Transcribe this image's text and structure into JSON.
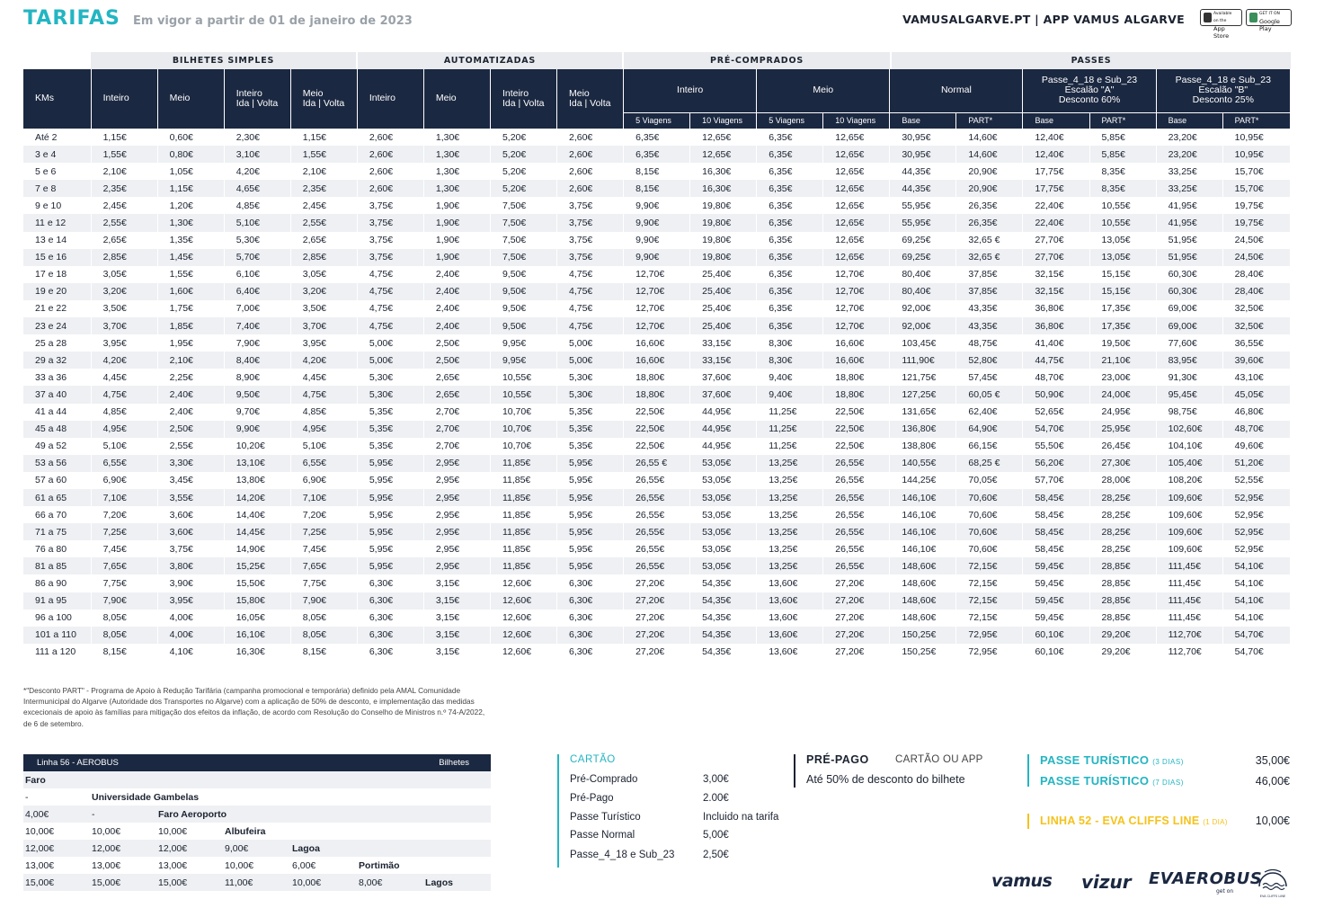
{
  "header": {
    "title": "TARIFAS",
    "subtitle": "Em vigor a partir de 01 de janeiro de 2023",
    "links": "VAMUSALGARVE.PT  |  APP VAMUS ALGARVE",
    "app_store_small": "Available on the",
    "app_store": "App Store",
    "google_play_small": "GET IT ON",
    "google_play": "Google Play"
  },
  "groups": {
    "bilhetes": "BILHETES SIMPLES",
    "automatizadas": "AUTOMATIZADAS",
    "precomprados": "PRÉ-COMPRADOS",
    "passes": "PASSES"
  },
  "columns": {
    "kms": "KMs",
    "inteiro": "Inteiro",
    "meio": "Meio",
    "inteiro_iv_1": "Inteiro",
    "inteiro_iv_2": "Ida | Volta",
    "meio_iv_1": "Meio",
    "meio_iv_2": "Ida | Volta",
    "pc_inteiro": "Inteiro",
    "pc_meio": "Meio",
    "normal": "Normal",
    "passe_a_1": "Passe_4_18 e Sub_23",
    "passe_a_2": "Escalão \"A\"",
    "passe_a_3": "Desconto 60%",
    "passe_b_1": "Passe_4_18 e Sub_23",
    "passe_b_2": "Escalão \"B\"",
    "passe_b_3": "Desconto 25%",
    "v5": "5 Viagens",
    "v10": "10 Viagens",
    "base": "Base",
    "part": "PART*"
  },
  "rows": [
    [
      "Até 2",
      "1,15€",
      "0,60€",
      "2,30€",
      "1,15€",
      "2,60€",
      "1,30€",
      "5,20€",
      "2,60€",
      "6,35€",
      "12,65€",
      "6,35€",
      "12,65€",
      "30,95€",
      "14,60€",
      "12,40€",
      "5,85€",
      "23,20€",
      "10,95€"
    ],
    [
      "3 e 4",
      "1,55€",
      "0,80€",
      "3,10€",
      "1,55€",
      "2,60€",
      "1,30€",
      "5,20€",
      "2,60€",
      "6,35€",
      "12,65€",
      "6,35€",
      "12,65€",
      "30,95€",
      "14,60€",
      "12,40€",
      "5,85€",
      "23,20€",
      "10,95€"
    ],
    [
      "5 e 6",
      "2,10€",
      "1,05€",
      "4,20€",
      "2,10€",
      "2,60€",
      "1,30€",
      "5,20€",
      "2,60€",
      "8,15€",
      "16,30€",
      "6,35€",
      "12,65€",
      "44,35€",
      "20,90€",
      "17,75€",
      "8,35€",
      "33,25€",
      "15,70€"
    ],
    [
      "7 e 8",
      "2,35€",
      "1,15€",
      "4,65€",
      "2,35€",
      "2,60€",
      "1,30€",
      "5,20€",
      "2,60€",
      "8,15€",
      "16,30€",
      "6,35€",
      "12,65€",
      "44,35€",
      "20,90€",
      "17,75€",
      "8,35€",
      "33,25€",
      "15,70€"
    ],
    [
      "9 e 10",
      "2,45€",
      "1,20€",
      "4,85€",
      "2,45€",
      "3,75€",
      "1,90€",
      "7,50€",
      "3,75€",
      "9,90€",
      "19,80€",
      "6,35€",
      "12,65€",
      "55,95€",
      "26,35€",
      "22,40€",
      "10,55€",
      "41,95€",
      "19,75€"
    ],
    [
      "11 e 12",
      "2,55€",
      "1,30€",
      "5,10€",
      "2,55€",
      "3,75€",
      "1,90€",
      "7,50€",
      "3,75€",
      "9,90€",
      "19,80€",
      "6,35€",
      "12,65€",
      "55,95€",
      "26,35€",
      "22,40€",
      "10,55€",
      "41,95€",
      "19,75€"
    ],
    [
      "13 e 14",
      "2,65€",
      "1,35€",
      "5,30€",
      "2,65€",
      "3,75€",
      "1,90€",
      "7,50€",
      "3,75€",
      "9,90€",
      "19,80€",
      "6,35€",
      "12,65€",
      "69,25€",
      "32,65 €",
      "27,70€",
      "13,05€",
      "51,95€",
      "24,50€"
    ],
    [
      "15 e 16",
      "2,85€",
      "1,45€",
      "5,70€",
      "2,85€",
      "3,75€",
      "1,90€",
      "7,50€",
      "3,75€",
      "9,90€",
      "19,80€",
      "6,35€",
      "12,65€",
      "69,25€",
      "32,65 €",
      "27,70€",
      "13,05€",
      "51,95€",
      "24,50€"
    ],
    [
      "17 e 18",
      "3,05€",
      "1,55€",
      "6,10€",
      "3,05€",
      "4,75€",
      "2,40€",
      "9,50€",
      "4,75€",
      "12,70€",
      "25,40€",
      "6,35€",
      "12,70€",
      "80,40€",
      "37,85€",
      "32,15€",
      "15,15€",
      "60,30€",
      "28,40€"
    ],
    [
      "19 e 20",
      "3,20€",
      "1,60€",
      "6,40€",
      "3,20€",
      "4,75€",
      "2,40€",
      "9,50€",
      "4,75€",
      "12,70€",
      "25,40€",
      "6,35€",
      "12,70€",
      "80,40€",
      "37,85€",
      "32,15€",
      "15,15€",
      "60,30€",
      "28,40€"
    ],
    [
      "21 e 22",
      "3,50€",
      "1,75€",
      "7,00€",
      "3,50€",
      "4,75€",
      "2,40€",
      "9,50€",
      "4,75€",
      "12,70€",
      "25,40€",
      "6,35€",
      "12,70€",
      "92,00€",
      "43,35€",
      "36,80€",
      "17,35€",
      "69,00€",
      "32,50€"
    ],
    [
      "23 e 24",
      "3,70€",
      "1,85€",
      "7,40€",
      "3,70€",
      "4,75€",
      "2,40€",
      "9,50€",
      "4,75€",
      "12,70€",
      "25,40€",
      "6,35€",
      "12,70€",
      "92,00€",
      "43,35€",
      "36,80€",
      "17,35€",
      "69,00€",
      "32,50€"
    ],
    [
      "25 a 28",
      "3,95€",
      "1,95€",
      "7,90€",
      "3,95€",
      "5,00€",
      "2,50€",
      "9,95€",
      "5,00€",
      "16,60€",
      "33,15€",
      "8,30€",
      "16,60€",
      "103,45€",
      "48,75€",
      "41,40€",
      "19,50€",
      "77,60€",
      "36,55€"
    ],
    [
      "29 a 32",
      "4,20€",
      "2,10€",
      "8,40€",
      "4,20€",
      "5,00€",
      "2,50€",
      "9,95€",
      "5,00€",
      "16,60€",
      "33,15€",
      "8,30€",
      "16,60€",
      "111,90€",
      "52,80€",
      "44,75€",
      "21,10€",
      "83,95€",
      "39,60€"
    ],
    [
      "33 a 36",
      "4,45€",
      "2,25€",
      "8,90€",
      "4,45€",
      "5,30€",
      "2,65€",
      "10,55€",
      "5,30€",
      "18,80€",
      "37,60€",
      "9,40€",
      "18,80€",
      "121,75€",
      "57,45€",
      "48,70€",
      "23,00€",
      "91,30€",
      "43,10€"
    ],
    [
      "37 a 40",
      "4,75€",
      "2,40€",
      "9,50€",
      "4,75€",
      "5,30€",
      "2,65€",
      "10,55€",
      "5,30€",
      "18,80€",
      "37,60€",
      "9,40€",
      "18,80€",
      "127,25€",
      "60,05 €",
      "50,90€",
      "24,00€",
      "95,45€",
      "45,05€"
    ],
    [
      "41 a 44",
      "4,85€",
      "2,40€",
      "9,70€",
      "4,85€",
      "5,35€",
      "2,70€",
      "10,70€",
      "5,35€",
      "22,50€",
      "44,95€",
      "11,25€",
      "22,50€",
      "131,65€",
      "62,40€",
      "52,65€",
      "24,95€",
      "98,75€",
      "46,80€"
    ],
    [
      "45 a 48",
      "4,95€",
      "2,50€",
      "9,90€",
      "4,95€",
      "5,35€",
      "2,70€",
      "10,70€",
      "5,35€",
      "22,50€",
      "44,95€",
      "11,25€",
      "22,50€",
      "136,80€",
      "64,90€",
      "54,70€",
      "25,95€",
      "102,60€",
      "48,70€"
    ],
    [
      "49 a 52",
      "5,10€",
      "2,55€",
      "10,20€",
      "5,10€",
      "5,35€",
      "2,70€",
      "10,70€",
      "5,35€",
      "22,50€",
      "44,95€",
      "11,25€",
      "22,50€",
      "138,80€",
      "66,15€",
      "55,50€",
      "26,45€",
      "104,10€",
      "49,60€"
    ],
    [
      "53 a 56",
      "6,55€",
      "3,30€",
      "13,10€",
      "6,55€",
      "5,95€",
      "2,95€",
      "11,85€",
      "5,95€",
      "26,55 €",
      "53,05€",
      "13,25€",
      "26,55€",
      "140,55€",
      "68,25 €",
      "56,20€",
      "27,30€",
      "105,40€",
      "51,20€"
    ],
    [
      "57 a 60",
      "6,90€",
      "3,45€",
      "13,80€",
      "6,90€",
      "5,95€",
      "2,95€",
      "11,85€",
      "5,95€",
      "26,55€",
      "53,05€",
      "13,25€",
      "26,55€",
      "144,25€",
      "70,05€",
      "57,70€",
      "28,00€",
      "108,20€",
      "52,55€"
    ],
    [
      "61 a 65",
      "7,10€",
      "3,55€",
      "14,20€",
      "7,10€",
      "5,95€",
      "2,95€",
      "11,85€",
      "5,95€",
      "26,55€",
      "53,05€",
      "13,25€",
      "26,55€",
      "146,10€",
      "70,60€",
      "58,45€",
      "28,25€",
      "109,60€",
      "52,95€"
    ],
    [
      "66 a 70",
      "7,20€",
      "3,60€",
      "14,40€",
      "7,20€",
      "5,95€",
      "2,95€",
      "11,85€",
      "5,95€",
      "26,55€",
      "53,05€",
      "13,25€",
      "26,55€",
      "146,10€",
      "70,60€",
      "58,45€",
      "28,25€",
      "109,60€",
      "52,95€"
    ],
    [
      "71 a 75",
      "7,25€",
      "3,60€",
      "14,45€",
      "7,25€",
      "5,95€",
      "2,95€",
      "11,85€",
      "5,95€",
      "26,55€",
      "53,05€",
      "13,25€",
      "26,55€",
      "146,10€",
      "70,60€",
      "58,45€",
      "28,25€",
      "109,60€",
      "52,95€"
    ],
    [
      "76 a 80",
      "7,45€",
      "3,75€",
      "14,90€",
      "7,45€",
      "5,95€",
      "2,95€",
      "11,85€",
      "5,95€",
      "26,55€",
      "53,05€",
      "13,25€",
      "26,55€",
      "146,10€",
      "70,60€",
      "58,45€",
      "28,25€",
      "109,60€",
      "52,95€"
    ],
    [
      "81 a 85",
      "7,65€",
      "3,80€",
      "15,25€",
      "7,65€",
      "5,95€",
      "2,95€",
      "11,85€",
      "5,95€",
      "26,55€",
      "53,05€",
      "13,25€",
      "26,55€",
      "148,60€",
      "72,15€",
      "59,45€",
      "28,85€",
      "111,45€",
      "54,10€"
    ],
    [
      "86 a 90",
      "7,75€",
      "3,90€",
      "15,50€",
      "7,75€",
      "6,30€",
      "3,15€",
      "12,60€",
      "6,30€",
      "27,20€",
      "54,35€",
      "13,60€",
      "27,20€",
      "148,60€",
      "72,15€",
      "59,45€",
      "28,85€",
      "111,45€",
      "54,10€"
    ],
    [
      "91 a 95",
      "7,90€",
      "3,95€",
      "15,80€",
      "7,90€",
      "6,30€",
      "3,15€",
      "12,60€",
      "6,30€",
      "27,20€",
      "54,35€",
      "13,60€",
      "27,20€",
      "148,60€",
      "72,15€",
      "59,45€",
      "28,85€",
      "111,45€",
      "54,10€"
    ],
    [
      "96 a 100",
      "8,05€",
      "4,00€",
      "16,05€",
      "8,05€",
      "6,30€",
      "3,15€",
      "12,60€",
      "6,30€",
      "27,20€",
      "54,35€",
      "13,60€",
      "27,20€",
      "148,60€",
      "72,15€",
      "59,45€",
      "28,85€",
      "111,45€",
      "54,10€"
    ],
    [
      "101 a 110",
      "8,05€",
      "4,00€",
      "16,10€",
      "8,05€",
      "6,30€",
      "3,15€",
      "12,60€",
      "6,30€",
      "27,20€",
      "54,35€",
      "13,60€",
      "27,20€",
      "150,25€",
      "72,95€",
      "60,10€",
      "29,20€",
      "112,70€",
      "54,70€"
    ],
    [
      "111 a 120",
      "8,15€",
      "4,10€",
      "16,30€",
      "8,15€",
      "6,30€",
      "3,15€",
      "12,60€",
      "6,30€",
      "27,20€",
      "54,35€",
      "13,60€",
      "27,20€",
      "150,25€",
      "72,95€",
      "60,10€",
      "29,20€",
      "112,70€",
      "54,70€"
    ]
  ],
  "footnote": "*\"Desconto PART\" - Programa de Apoio à Redução Tarifária (campanha promocional e temporária) definido pela AMAL Comunidade Intermunicipal do Algarve (Autoridade dos Transportes no Algarve) com a aplicação de 50% de desconto, e implementação das medidas excecionais de apoio às famílias para mitigação dos efeitos da inflação, de acordo com Resolução do Conselho de Ministros n.º 74-A/2022, de 6 de setembro.",
  "aerobus": {
    "title": "Linha 56 - AEROBUS",
    "right": "Bilhetes",
    "rows": [
      [
        [
          "Faro",
          true
        ]
      ],
      [
        [
          "-",
          false
        ],
        [
          "Universidade Gambelas",
          true
        ]
      ],
      [
        [
          "4,00€",
          false
        ],
        [
          "-",
          false
        ],
        [
          "Faro Aeroporto",
          true
        ]
      ],
      [
        [
          "10,00€",
          false
        ],
        [
          "10,00€",
          false
        ],
        [
          "10,00€",
          false
        ],
        [
          "Albufeira",
          true
        ]
      ],
      [
        [
          "12,00€",
          false
        ],
        [
          "12,00€",
          false
        ],
        [
          "12,00€",
          false
        ],
        [
          "9,00€",
          false
        ],
        [
          "Lagoa",
          true
        ]
      ],
      [
        [
          "13,00€",
          false
        ],
        [
          "13,00€",
          false
        ],
        [
          "13,00€",
          false
        ],
        [
          "10,00€",
          false
        ],
        [
          "6,00€",
          false
        ],
        [
          "Portimão",
          true
        ]
      ],
      [
        [
          "15,00€",
          false
        ],
        [
          "15,00€",
          false
        ],
        [
          "15,00€",
          false
        ],
        [
          "11,00€",
          false
        ],
        [
          "10,00€",
          false
        ],
        [
          "8,00€",
          false
        ],
        [
          "Lagos",
          true
        ]
      ]
    ]
  },
  "cartao": {
    "title": "CARTÃO",
    "items": [
      {
        "label": "Pré-Comprado",
        "value": "3,00€"
      },
      {
        "label": "Pré-Pago",
        "value": "2.00€"
      },
      {
        "label": "Passe Turístico",
        "value": "Incluido na tarifa"
      },
      {
        "label": "Passe Normal",
        "value": "5,00€"
      },
      {
        "label": "Passe_4_18 e Sub_23",
        "value": "2,50€"
      }
    ]
  },
  "prepago": {
    "title": "PRÉ-PAGO",
    "subtitle": "CARTÃO OU APP",
    "desc": "Até 50% de desconto do bilhete"
  },
  "turistico": [
    {
      "label": "PASSE TURÍSTICO",
      "period": "(3 DIAS)",
      "value": "35,00€"
    },
    {
      "label": "PASSE TURÍSTICO",
      "period": "(7 DIAS)",
      "value": "46,00€"
    }
  ],
  "linha52": {
    "label": "LINHA 52 - EVA CLIFFS LINE",
    "period": "(1 DIA)",
    "value": "10,00€"
  },
  "logos": {
    "vamus": "vamus",
    "vizur": "vizur",
    "aerobus": "EVAEROBUS",
    "aerobus_sub": "get on",
    "cliffs": "EVA CLIFFS LINE"
  },
  "colors": {
    "accent": "#23b5c2",
    "navy": "#1b2841",
    "yellow": "#f5c21b"
  }
}
